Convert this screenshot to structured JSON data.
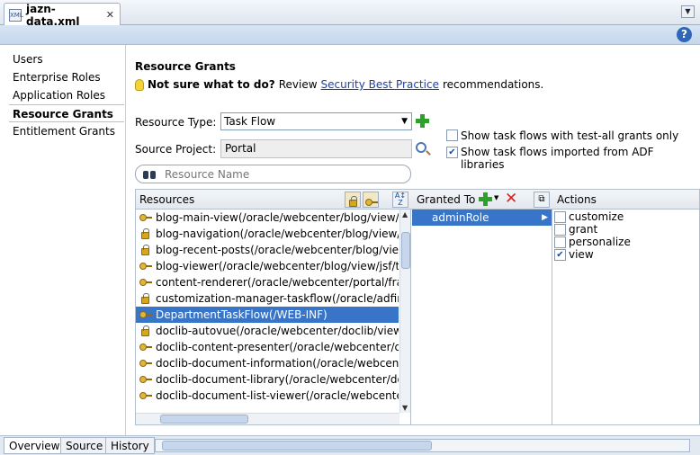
{
  "tab": {
    "title": "jazn-data.xml",
    "close": "✕",
    "file_icon": "xml-file-icon",
    "dropdown": "▼"
  },
  "help": {
    "glyph": "?"
  },
  "nav": {
    "items": [
      {
        "label": "Users",
        "active": false
      },
      {
        "label": "Enterprise Roles",
        "active": false
      },
      {
        "label": "Application Roles",
        "active": false
      },
      {
        "label": "Resource Grants",
        "active": true
      },
      {
        "label": "Entitlement Grants",
        "active": false
      }
    ]
  },
  "main": {
    "title": "Resource Grants",
    "hint": {
      "bold": "Not sure what to do?",
      "before": "Review",
      "link": "Security Best Practice",
      "after": "recommendations."
    },
    "resource_type": {
      "label": "Resource Type:",
      "value": "Task Flow"
    },
    "source_project": {
      "label": "Source Project:",
      "value": "Portal"
    },
    "options": [
      {
        "label": "Show task flows with test-all grants only",
        "checked": false
      },
      {
        "label": "Show task flows imported from ADF libraries",
        "checked": true
      }
    ],
    "filter": {
      "placeholder": "Resource Name"
    }
  },
  "resources": {
    "header": "Resources",
    "rows": [
      {
        "icon": "key",
        "label": "blog-main-view(/oracle/webcenter/blog/view/jsf/",
        "selected": false
      },
      {
        "icon": "lock",
        "label": "blog-navigation(/oracle/webcenter/blog/view/jsf/",
        "selected": false
      },
      {
        "icon": "lock",
        "label": "blog-recent-posts(/oracle/webcenter/blog/view/j",
        "selected": false
      },
      {
        "icon": "key",
        "label": "blog-viewer(/oracle/webcenter/blog/view/jsf/task",
        "selected": false
      },
      {
        "icon": "key",
        "label": "content-renderer(/oracle/webcenter/portal/fram",
        "selected": false
      },
      {
        "icon": "lock",
        "label": "customization-manager-taskflow(/oracle/adfinte",
        "selected": false
      },
      {
        "icon": "key",
        "label": "DepartmentTaskFlow(/WEB-INF)",
        "selected": true
      },
      {
        "icon": "lock",
        "label": "doclib-autovue(/oracle/webcenter/doclib/view/jsf",
        "selected": false
      },
      {
        "icon": "key",
        "label": "doclib-content-presenter(/oracle/webcenter/doc",
        "selected": false
      },
      {
        "icon": "key",
        "label": "doclib-document-information(/oracle/webcenter/",
        "selected": false
      },
      {
        "icon": "key",
        "label": "doclib-document-library(/oracle/webcenter/docli",
        "selected": false
      },
      {
        "icon": "key",
        "label": "doclib-document-list-viewer(/oracle/webcenter/d",
        "selected": false
      }
    ]
  },
  "granted": {
    "header": "Granted To",
    "rows": [
      {
        "label": "adminRole"
      }
    ]
  },
  "actions": {
    "header": "Actions",
    "items": [
      {
        "label": "customize",
        "checked": false
      },
      {
        "label": "grant",
        "checked": false
      },
      {
        "label": "personalize",
        "checked": false
      },
      {
        "label": "view",
        "checked": true
      }
    ]
  },
  "bottom_tabs": [
    {
      "label": "Overview",
      "active": true
    },
    {
      "label": "Source",
      "active": false
    },
    {
      "label": "History",
      "active": false
    }
  ],
  "colors": {
    "selection": "#3874c8",
    "link": "#1b3fa8",
    "add": "#2ea12a",
    "delete": "#d62222"
  }
}
